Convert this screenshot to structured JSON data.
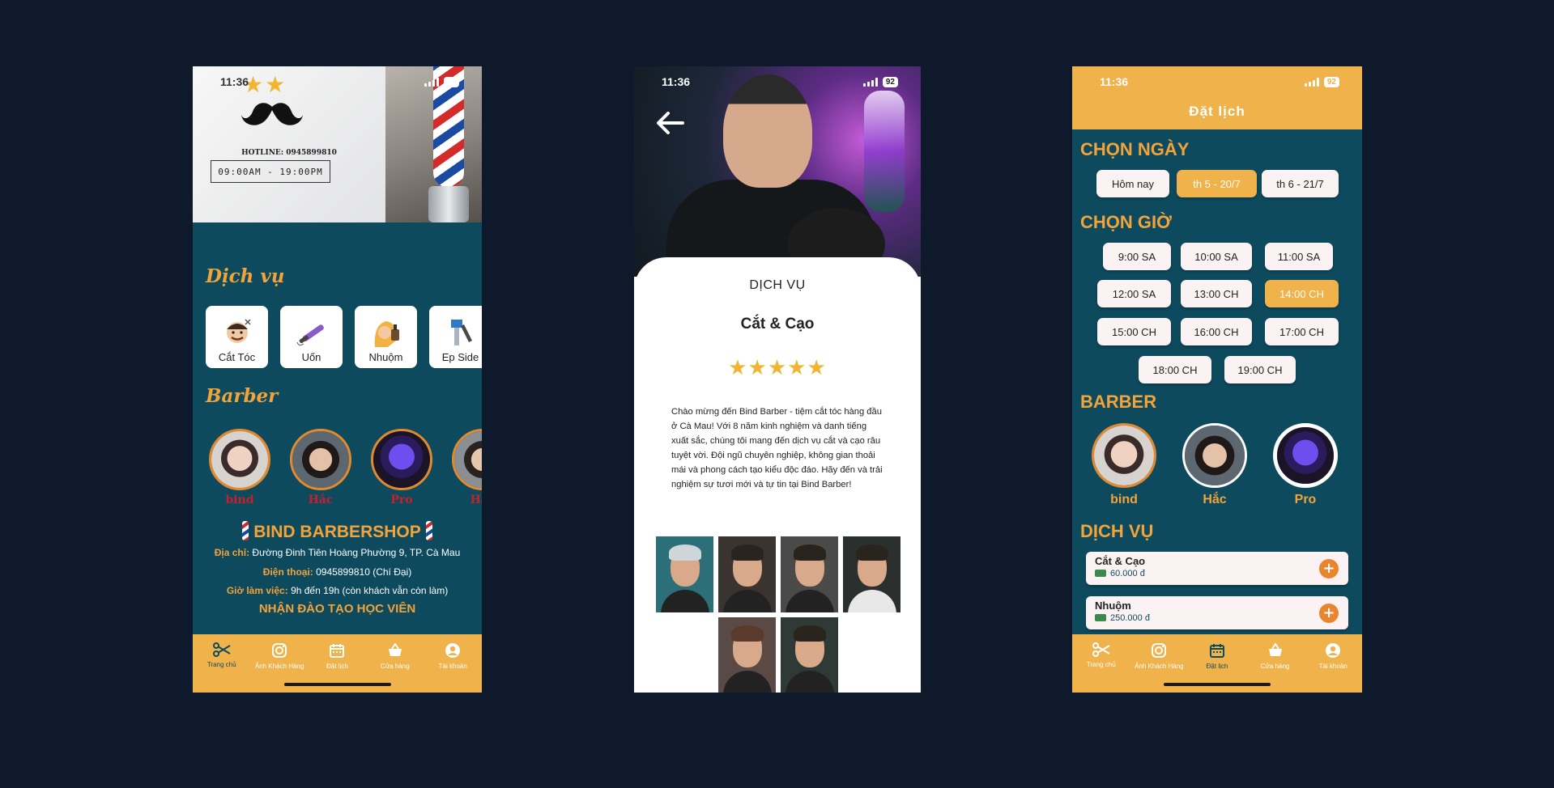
{
  "status": {
    "time": "11:36",
    "battery": "92"
  },
  "screen_home": {
    "hotline": "HOTLINE: 0945899810",
    "hours": "09:00AM - 19:00PM",
    "services_title": "Dịch vụ",
    "services": [
      {
        "label": "Cắt Tóc",
        "icon": "haircut-icon"
      },
      {
        "label": "Uốn",
        "icon": "curling-iron-icon"
      },
      {
        "label": "Nhuộm",
        "icon": "hair-dye-icon"
      },
      {
        "label": "Ep Side",
        "icon": "hair-tool-icon"
      }
    ],
    "barbers_title": "Barber",
    "barbers": [
      "bind",
      "Hắc",
      "Pro",
      "Hắc"
    ],
    "shop_name": "BIND BARBERSHOP",
    "address_label": "Địa chỉ:",
    "address": "Đường Đinh Tiên Hoàng Phường 9, TP. Cà Mau",
    "phone_label": "Điện thoại:",
    "phone": "0945899810 (Chí Đại)",
    "hours_label": "Giờ làm việc:",
    "hours_text": "9h đến 19h (còn khách vẫn còn làm)",
    "training": "NHẬN ĐÀO TẠO HỌC VIÊN"
  },
  "tabs": [
    "Trang chủ",
    "Ảnh Khách Hàng",
    "Đặt lịch",
    "Cửa hàng",
    "Tài khoản"
  ],
  "screen_service": {
    "subtitle": "DỊCH VỤ",
    "title": "Cắt & Cạo",
    "rating": 5,
    "stars": "★★★★★",
    "description": "Chào mừng đến Bind Barber - tiệm cắt tóc hàng đầu ở Cà Mau!  Với 8 năm kinh nghiệm và danh tiếng xuất sắc, chúng tôi mang đến dịch vụ cắt và cạo râu tuyệt vời.  Đội ngũ chuyên nghiệp, không gian thoải mái và phong cách tạo kiểu độc đáo.  Hãy đến và trải nghiệm sự tươi mới và tự tin tại Bind Barber!"
  },
  "screen_booking": {
    "title": "Đặt lịch",
    "date_title": "CHỌN NGÀY",
    "dates": [
      "Hôm nay",
      "th 5 - 20/7",
      "th 6 - 21/7"
    ],
    "selected_date": "th 5 - 20/7",
    "time_title": "CHỌN GIỜ",
    "times": [
      "9:00 SA",
      "10:00 SA",
      "11:00 SA",
      "12:00 SA",
      "13:00 CH",
      "14:00 CH",
      "15:00 CH",
      "16:00 CH",
      "17:00 CH",
      "18:00 CH",
      "19:00 CH"
    ],
    "selected_time": "14:00 CH",
    "barber_title": "BARBER",
    "barbers": [
      "bind",
      "Hắc",
      "Pro"
    ],
    "service_title": "DỊCH VỤ",
    "services": [
      {
        "name": "Cắt & Cạo",
        "price": "60.000 đ"
      },
      {
        "name": "Nhuộm",
        "price": "250.000 đ"
      }
    ]
  },
  "colors": {
    "background": "#0e1a2b",
    "teal": "#0e4a5e",
    "amber": "#f0b24a",
    "orange": "#e9852e",
    "red": "#c8202a"
  }
}
